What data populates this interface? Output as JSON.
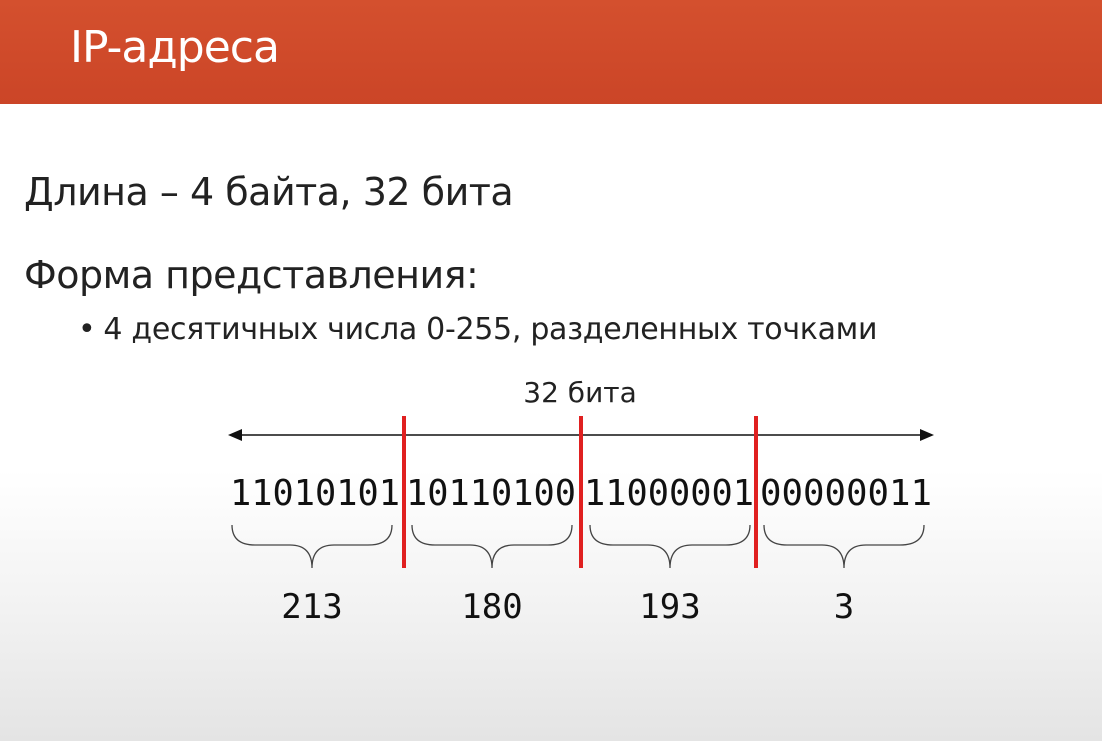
{
  "header": {
    "title": "IP-адреса",
    "accent_color": "#cf4a2b"
  },
  "content": {
    "line1": "Длина – 4 байта, 32 бита",
    "line2": "Форма представления:",
    "bullet": "4 десятичных числа 0-255, разделенных точками"
  },
  "diagram": {
    "span_label": "32 бита",
    "octets": [
      {
        "binary": "11010101",
        "decimal": "213"
      },
      {
        "binary": "10110100",
        "decimal": "180"
      },
      {
        "binary": "11000001",
        "decimal": "193"
      },
      {
        "binary": "00000011",
        "decimal": "3"
      }
    ],
    "divider_color": "#e02020"
  }
}
